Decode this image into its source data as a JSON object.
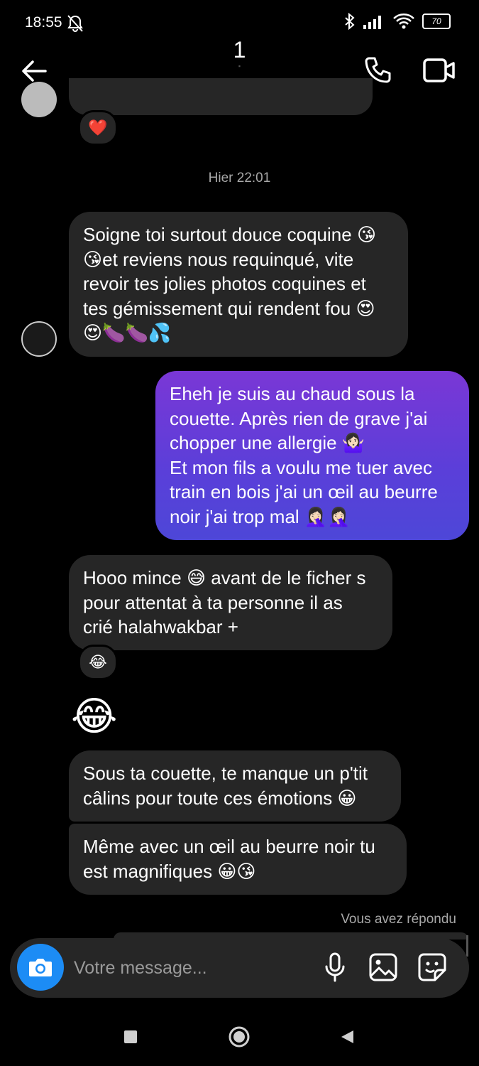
{
  "status_bar": {
    "time": "18:55",
    "battery": "70"
  },
  "header": {
    "title": "1",
    "subtitle": "▪"
  },
  "reaction_top": "❤️",
  "timestamp": "Hier 22:01",
  "messages": [
    {
      "direction": "in",
      "text": "Soigne toi surtout  douce coquine 😘😘et reviens nous requinqué, vite revoir tes jolies photos coquines et tes gémissement qui rendent fou 😍😍🍆🍆💦"
    },
    {
      "direction": "out",
      "text": "Eheh je suis au chaud sous la couette. Après rien de grave j'ai chopper une allergie 🤷🏻‍♀️\nEt mon fils a voulu me tuer avec train en bois j'ai un œil au beurre noir j'ai trop mal 🤦🏻‍♀️🤦🏻‍♀️"
    },
    {
      "direction": "in",
      "text": "Hooo mince 😅 avant de le ficher s pour attentat à ta personne il as crié halahwakbar +",
      "reaction": "😂"
    },
    {
      "direction": "in",
      "text": "😂"
    },
    {
      "direction": "in",
      "text": "Sous ta couette, te manque un p'tit câlins pour toute ces émotions 😀"
    },
    {
      "direction": "in",
      "text": "Même avec un œil au beurre noir tu est magnifiques 😀😘"
    }
  ],
  "replied_label": "Vous avez répondu",
  "composer": {
    "placeholder": "Votre message..."
  },
  "colors": {
    "accent": "#1c8cf5",
    "bubble_in": "#262626",
    "bubble_out_top": "#7a37d6",
    "bubble_out_bottom": "#4d47d8"
  }
}
